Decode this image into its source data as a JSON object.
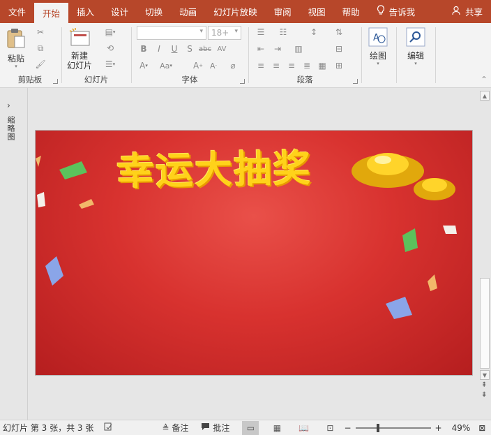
{
  "tabs": [
    "文件",
    "开始",
    "插入",
    "设计",
    "切换",
    "动画",
    "幻灯片放映",
    "审阅",
    "视图",
    "帮助"
  ],
  "active_tab": "开始",
  "tell_me": "告诉我",
  "share": "共享",
  "ribbon": {
    "clipboard": {
      "paste_label": "粘贴",
      "group_label": "剪贴板"
    },
    "slides": {
      "new_slide_label": "新建\n幻灯片",
      "group_label": "幻灯片"
    },
    "font": {
      "size_value": "18+",
      "group_label": "字体"
    },
    "paragraph": {
      "group_label": "段落"
    },
    "drawing": {
      "label": "绘图"
    },
    "editing": {
      "label": "编辑"
    }
  },
  "left_pane": {
    "label": "缩略图"
  },
  "slide": {
    "title": "幸运大抽奖"
  },
  "status_bar": {
    "slide_info": "幻灯片 第 3 张，共 3 张",
    "notes": "备注",
    "comments": "批注",
    "zoom": "49%"
  },
  "colors": {
    "accent": "#b7472a",
    "slide_red": "#d8322f",
    "title_gold": "#ffd21a"
  }
}
